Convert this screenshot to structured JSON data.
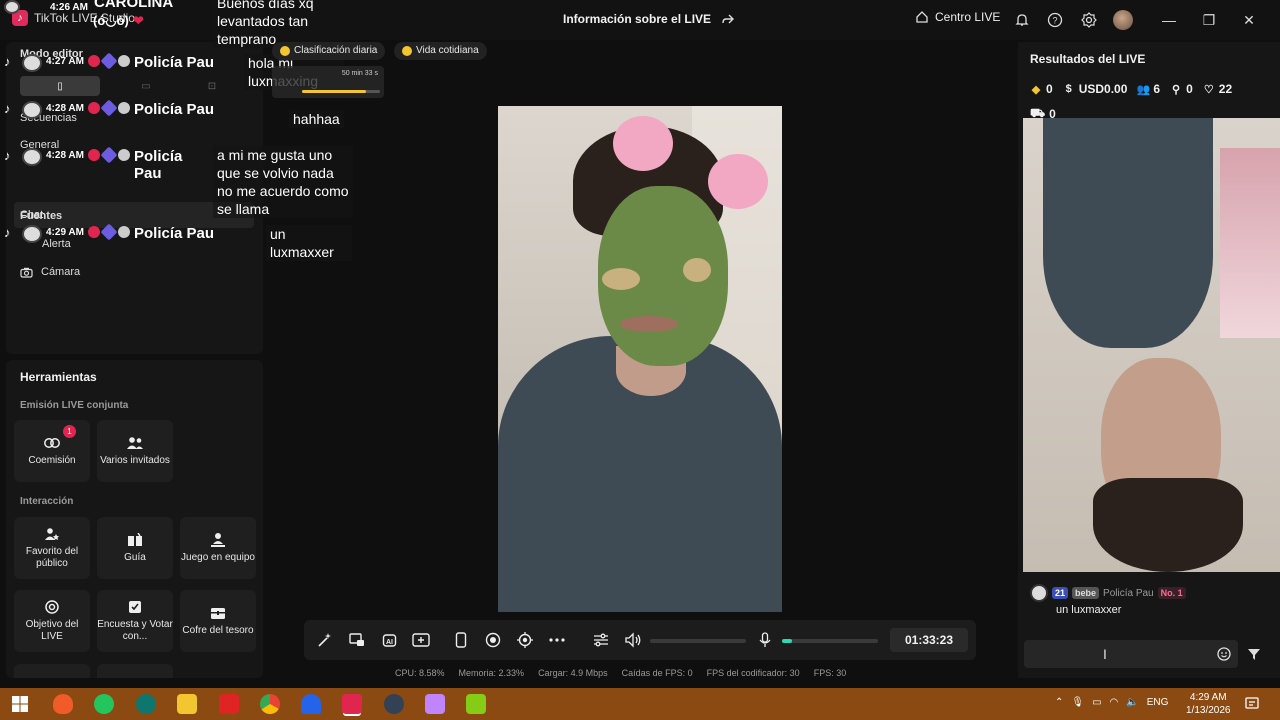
{
  "titlebar": {
    "app_name": "TikTok LIVE Studio",
    "live_info": "Información sobre el LIVE",
    "centro_live": "Centro LIVE"
  },
  "left": {
    "modo_editor": "Modo editor",
    "secuencias": "Secuencias",
    "general": "General",
    "chat": "Chat",
    "fuentes": "Fuentes",
    "alerta": "Alerta",
    "camara": "Cámara"
  },
  "tools": {
    "title": "Herramientas",
    "emision_label": "Emisión LIVE conjunta",
    "interaccion_label": "Interacción",
    "coemision": "Coemisión",
    "coemision_badge": "1",
    "varios_invitados": "Varios invitados",
    "favorito": "Favorito del público",
    "guia": "Guía",
    "juego": "Juego en equipo",
    "objetivo": "Objetivo del LIVE",
    "encuesta": "Encuesta y Votar con...",
    "cofre": "Cofre del tesoro"
  },
  "overlay": {
    "top_name": "CAROLINA",
    "top_badge": "(ó◡ò)",
    "rows": [
      {
        "time": "4:26 AM",
        "name": "",
        "message": "Buenos días xq levantados tan temprano"
      },
      {
        "time": "4:27 AM",
        "name": "Policía Pau",
        "message": "hola mi luxmaxxing"
      },
      {
        "time": "4:28 AM",
        "name": "Policía Pau",
        "message": "hahhaa"
      },
      {
        "time": "4:28 AM",
        "name": "Policía Pau",
        "message": "a mi me gusta uno que se volvio nada no me acuerdo como se llama"
      },
      {
        "time": "4:29 AM",
        "name": "Policía Pau",
        "message": "un luxmaxxer"
      }
    ]
  },
  "stream": {
    "chip_ranking": "Clasificación diaria",
    "chip_category": "Vida cotidiana",
    "progress_time": "50 min 33 s",
    "progress_fraction": 0.82
  },
  "right": {
    "title": "Resultados del LIVE",
    "stat_diamonds": "0",
    "stat_usd": "USD0.00",
    "stat_viewers": "6",
    "stat_follows": "0",
    "stat_likes": "22",
    "stat_gifts": "0",
    "comment": {
      "level": "21",
      "tag": "bebe",
      "name": "Policía Pau",
      "rank": "No. 1",
      "message": "un luxmaxxer"
    }
  },
  "bottom": {
    "timer": "01:33:23",
    "volume_fraction": 0.0,
    "mic_fraction": 0.1
  },
  "status": {
    "cpu": "CPU: 8.58%",
    "memoria": "Memoria: 2.33%",
    "cargar": "Cargar: 4.9 Mbps",
    "caidas": "Caídas de FPS: 0",
    "fps_cod": "FPS del codificador: 30",
    "fps": "FPS: 30"
  },
  "taskbar": {
    "lang": "ENG",
    "time": "4:29 AM",
    "date": "1/13/2026"
  },
  "colors": {
    "accent_pink": "#e0264f",
    "mic_green": "#2bd9b2",
    "gold": "#f2c531",
    "taskbar": "#8a4a12"
  }
}
